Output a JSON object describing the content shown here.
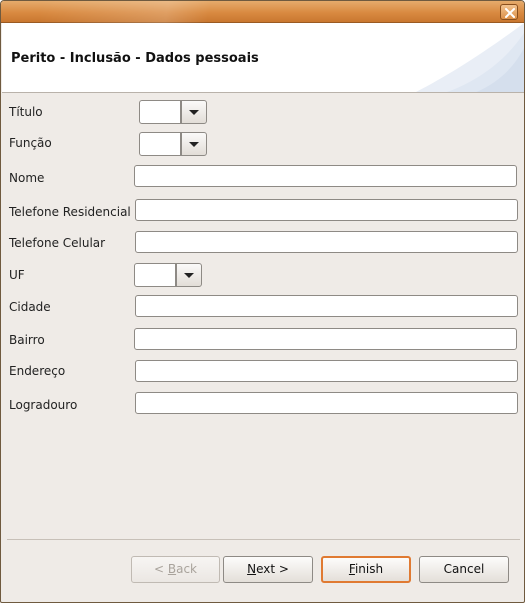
{
  "window": {
    "close_icon": "close-icon"
  },
  "header": {
    "title": "Perito - Inclusão - Dados pessoais"
  },
  "form": {
    "titulo_label": "Título",
    "funcao_label": "Função",
    "nome_label": "Nome",
    "telefone_residencial_label": "Telefone Residencial",
    "telefone_celular_label": "Telefone Celular",
    "uf_label": "UF",
    "cidade_label": "Cidade",
    "bairro_label": "Bairro",
    "endereco_label": "Endereço",
    "logradouro_label": "Logradouro",
    "titulo_value": "",
    "funcao_value": "",
    "nome_value": "",
    "telefone_residencial_value": "",
    "telefone_celular_value": "",
    "uf_value": "",
    "cidade_value": "",
    "bairro_value": "",
    "endereco_value": "",
    "logradouro_value": ""
  },
  "buttons": {
    "back_label": "< Back",
    "back_mnemonic": "B",
    "next_label": "Next >",
    "next_mnemonic": "N",
    "finish_label": "Finish",
    "finish_mnemonic": "F",
    "cancel_label": "Cancel"
  },
  "colors": {
    "titlebar": "#d98a41",
    "default_button_border": "#e07a32",
    "background": "#efebe7"
  }
}
